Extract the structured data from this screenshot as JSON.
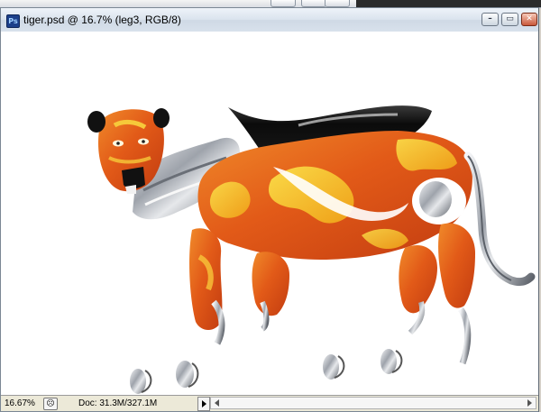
{
  "document_window": {
    "title": "tiger.psd @ 16.7% (leg3, RGB/8)",
    "app_icon_glyph": "Ps"
  },
  "window_buttons": {
    "minimize_glyph": "–",
    "maximize_glyph": "▭",
    "close_glyph": "✕"
  },
  "statusbar": {
    "zoom": "16.67%",
    "doc_info": "Doc: 31.3M/327.1M",
    "info_icon_glyph": "☹"
  },
  "canvas": {
    "subject": "tiger 3D render",
    "colors": {
      "orange": "#e8641e",
      "yellow": "#f5c21a",
      "black": "#111111",
      "chrome": "#c9ccd2",
      "background": "#ffffff"
    }
  }
}
